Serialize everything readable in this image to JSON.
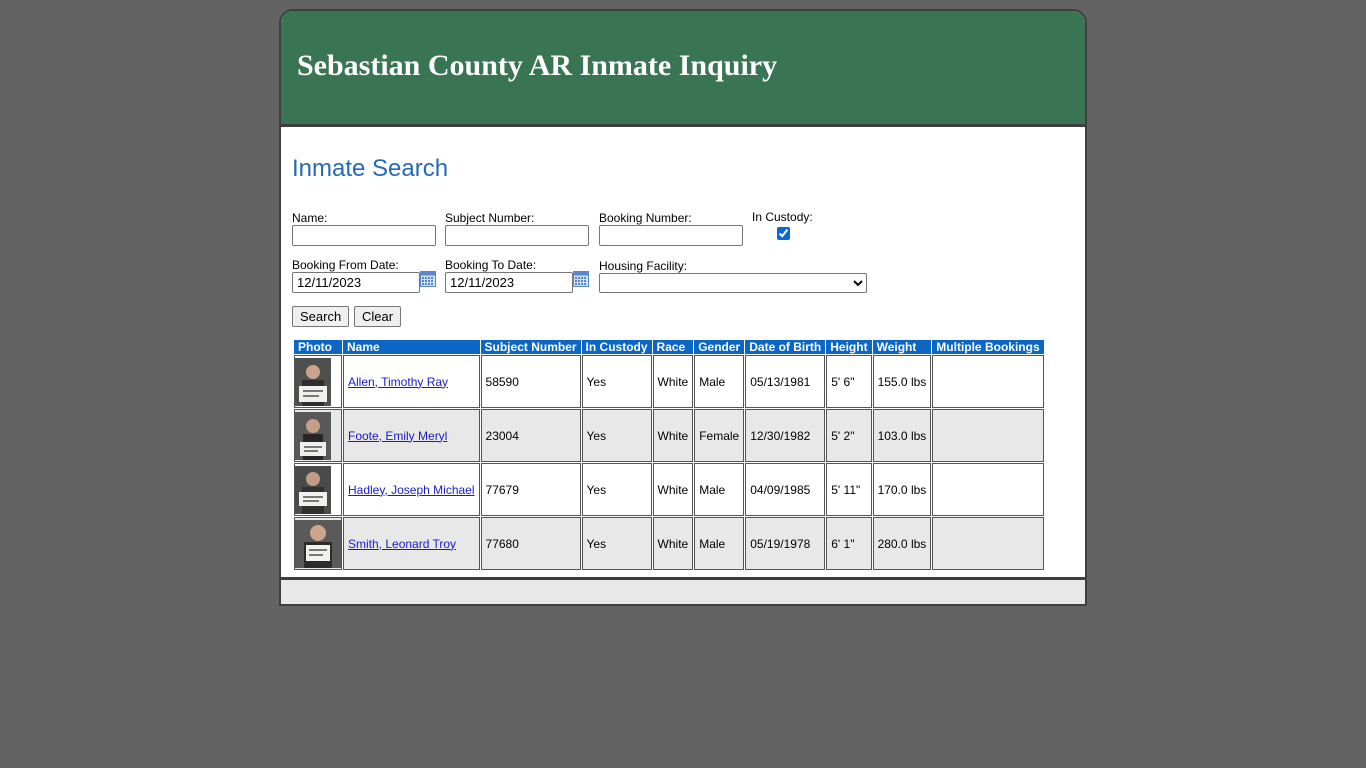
{
  "header": {
    "title": "Sebastian County AR Inmate Inquiry"
  },
  "search": {
    "title": "Inmate Search",
    "name_label": "Name:",
    "name_value": "",
    "subject_label": "Subject Number:",
    "subject_value": "",
    "booking_label": "Booking Number:",
    "booking_value": "",
    "custody_label": "In Custody:",
    "custody_checked": true,
    "from_label": "Booking From Date:",
    "from_value": "12/11/2023",
    "to_label": "Booking To Date:",
    "to_value": "12/11/2023",
    "facility_label": "Housing Facility:",
    "facility_value": "",
    "search_button": "Search",
    "clear_button": "Clear"
  },
  "results": {
    "columns": [
      "Photo",
      "Name",
      "Subject Number",
      "In Custody",
      "Race",
      "Gender",
      "Date of Birth",
      "Height",
      "Weight",
      "Multiple Bookings"
    ],
    "rows": [
      {
        "name": "Allen, Timothy Ray",
        "subject": "58590",
        "custody": "Yes",
        "race": "White",
        "gender": "Male",
        "dob": "05/13/1981",
        "height": "5' 6\"",
        "weight": "155.0 lbs",
        "multiple": ""
      },
      {
        "name": "Foote, Emily Meryl",
        "subject": "23004",
        "custody": "Yes",
        "race": "White",
        "gender": "Female",
        "dob": "12/30/1982",
        "height": "5' 2\"",
        "weight": "103.0 lbs",
        "multiple": ""
      },
      {
        "name": "Hadley, Joseph Michael",
        "subject": "77679",
        "custody": "Yes",
        "race": "White",
        "gender": "Male",
        "dob": "04/09/1985",
        "height": "5' 11\"",
        "weight": "170.0 lbs",
        "multiple": ""
      },
      {
        "name": "Smith, Leonard Troy",
        "subject": "77680",
        "custody": "Yes",
        "race": "White",
        "gender": "Male",
        "dob": "05/19/1978",
        "height": "6' 1\"",
        "weight": "280.0 lbs",
        "multiple": ""
      }
    ]
  },
  "colors": {
    "header_bg": "#397553",
    "page_bg": "#636363",
    "title_blue": "#2669b5",
    "table_header_bg": "#0b66c6",
    "link": "#1a1acc"
  },
  "icons": {
    "calendar": "calendar-icon",
    "mugshot": "mugshot-photo"
  }
}
